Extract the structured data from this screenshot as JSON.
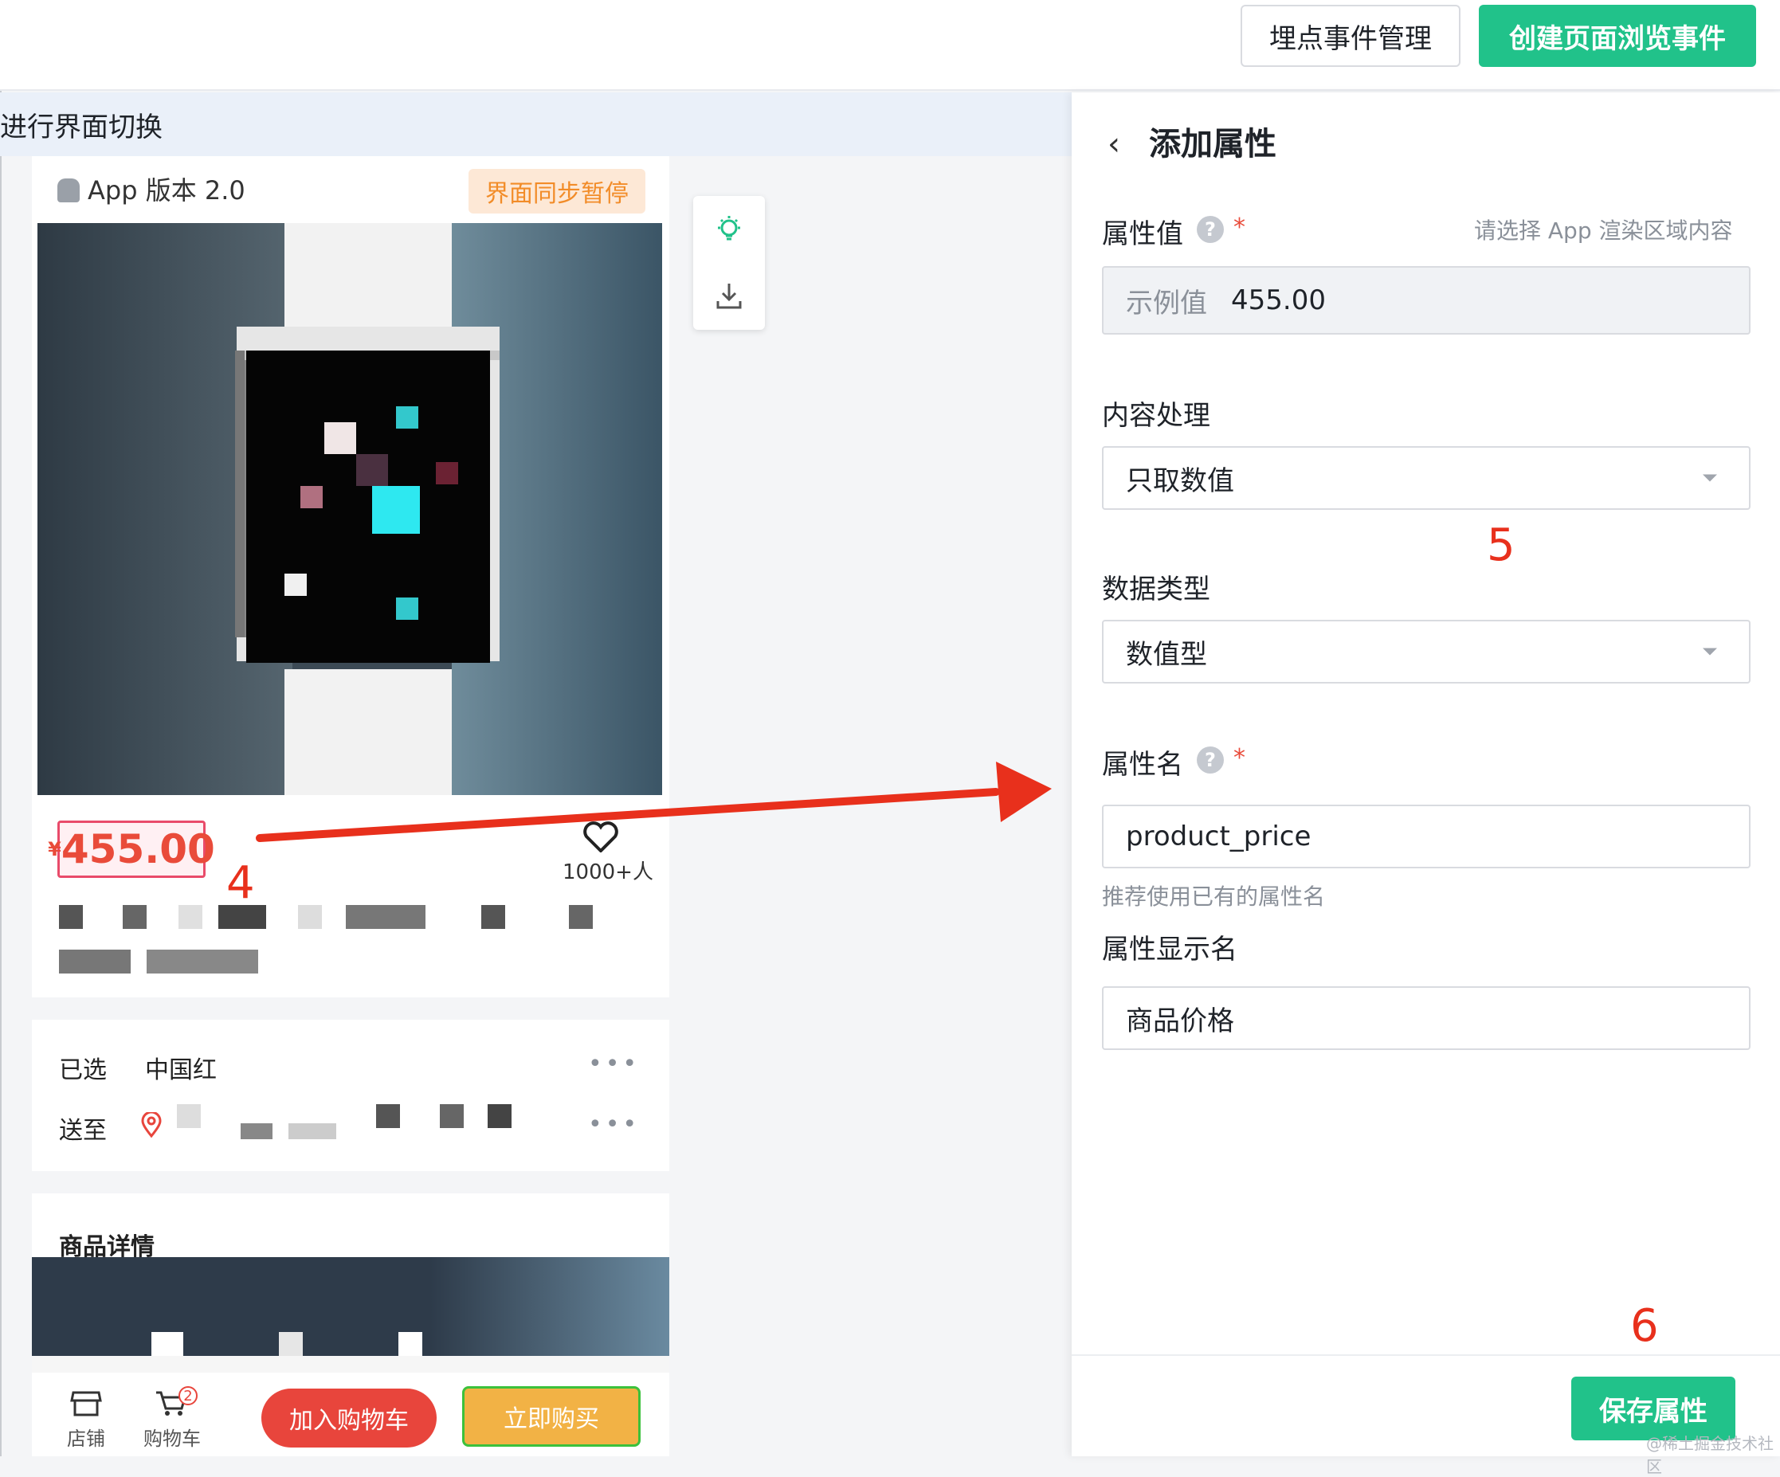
{
  "header": {
    "manage_button": "埋点事件管理",
    "create_button": "创建页面浏览事件"
  },
  "hint_bar": {
    "text": "进行界面切换"
  },
  "phone": {
    "app_version": "App 版本 2.0",
    "sync_badge": "界面同步暂停",
    "price": "455.00",
    "price_currency": "¥",
    "fav_count": "1000+人",
    "selected_label": "已选",
    "selected_value": "中国红",
    "ship_label": "送至",
    "more": "•••",
    "detail_title": "商品详情",
    "tabs": {
      "shop": "店铺",
      "cart": "购物车",
      "cart_badge": "2"
    },
    "add_cart_button": "加入购物车",
    "buy_button": "立即购买"
  },
  "panel": {
    "title": "添加属性",
    "attr_value_label": "属性值",
    "attr_value_hint": "请选择 App 渲染区域内容",
    "example_label": "示例值",
    "example_value": "455.00",
    "content_proc_label": "内容处理",
    "content_proc_value": "只取数值",
    "data_type_label": "数据类型",
    "data_type_value": "数值型",
    "attr_name_label": "属性名",
    "attr_name_value": "product_price",
    "attr_name_helper": "推荐使用已有的属性名",
    "display_name_label": "属性显示名",
    "display_name_value": "商品价格",
    "save_button": "保存属性",
    "required_mark": "*",
    "help_mark": "?"
  },
  "annotations": {
    "step4": "4",
    "step5": "5",
    "step6": "6"
  },
  "watermark": "@稀土掘金技术社区",
  "colors": {
    "accent": "#21c28a",
    "annotation_red": "#e8301c",
    "price_red": "#e94b3a"
  }
}
